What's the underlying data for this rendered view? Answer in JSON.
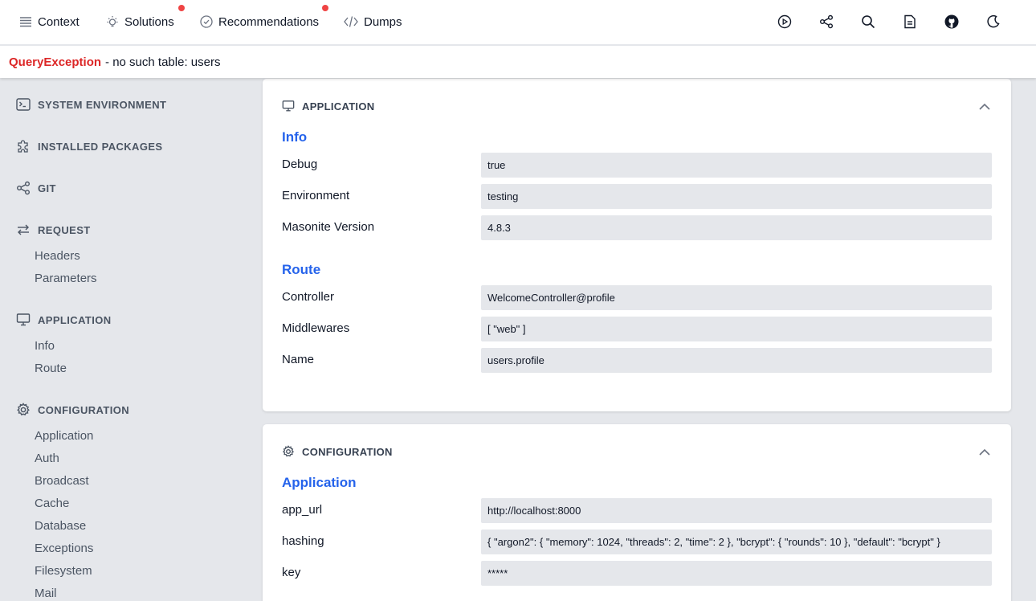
{
  "nav": {
    "context": "Context",
    "solutions": "Solutions",
    "recommendations": "Recommendations",
    "dumps": "Dumps"
  },
  "exception": {
    "name": "QueryException",
    "message": "- no such table: users"
  },
  "sidebar": {
    "system_environment": "SYSTEM ENVIRONMENT",
    "installed_packages": "INSTALLED PACKAGES",
    "git": "GIT",
    "request": "REQUEST",
    "request_items": [
      "Headers",
      "Parameters"
    ],
    "application": "APPLICATION",
    "application_items": [
      "Info",
      "Route"
    ],
    "configuration": "CONFIGURATION",
    "configuration_items": [
      "Application",
      "Auth",
      "Broadcast",
      "Cache",
      "Database",
      "Exceptions",
      "Filesystem",
      "Mail"
    ]
  },
  "application_card": {
    "title": "APPLICATION",
    "info_title": "Info",
    "info_rows": [
      {
        "label": "Debug",
        "value": "true"
      },
      {
        "label": "Environment",
        "value": "testing"
      },
      {
        "label": "Masonite Version",
        "value": "4.8.3"
      }
    ],
    "route_title": "Route",
    "route_rows": [
      {
        "label": "Controller",
        "value": "WelcomeController@profile"
      },
      {
        "label": "Middlewares",
        "value": "[ \"web\" ]"
      },
      {
        "label": "Name",
        "value": "users.profile"
      }
    ]
  },
  "configuration_card": {
    "title": "CONFIGURATION",
    "group_title": "Application",
    "rows": [
      {
        "label": "app_url",
        "value": "http://localhost:8000"
      },
      {
        "label": "hashing",
        "value": "{ \"argon2\": { \"memory\": 1024, \"threads\": 2, \"time\": 2 }, \"bcrypt\": { \"rounds\": 10 }, \"default\": \"bcrypt\" }"
      },
      {
        "label": "key",
        "value": "*****"
      }
    ]
  },
  "colors": {
    "accent": "#2563eb",
    "error": "#dc2626",
    "badge": "#ef4444",
    "background": "#e5e7eb"
  }
}
